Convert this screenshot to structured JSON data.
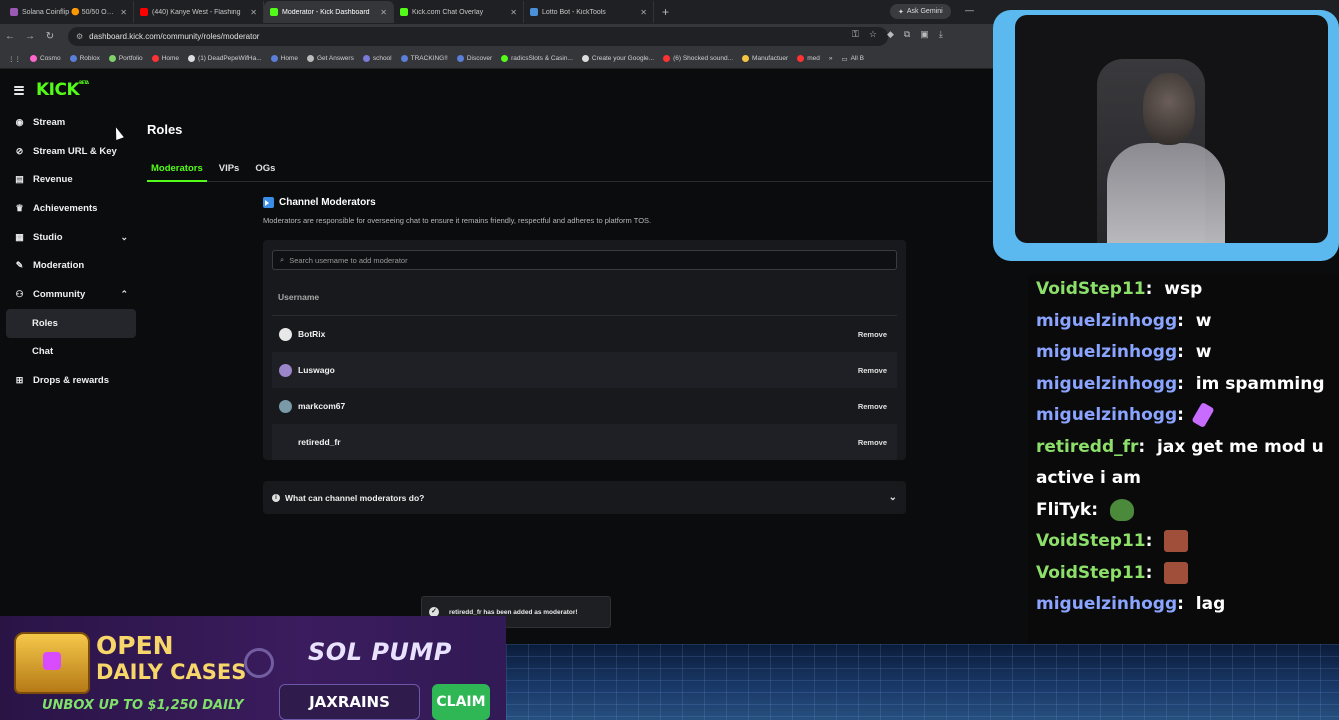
{
  "browser": {
    "tabs": [
      {
        "label": "Solana Coinflip 🟠 50/50 Odds",
        "color": "#9b59b6",
        "active": false
      },
      {
        "label": "(440) Kanye West - Flashing",
        "color": "#ff0000",
        "active": false
      },
      {
        "label": "Moderator - Kick Dashboard",
        "color": "#53fc18",
        "active": true
      },
      {
        "label": "Kick.com Chat Overlay",
        "color": "#53fc18",
        "active": false
      },
      {
        "label": "Lotto Bot - KickTools",
        "color": "#4a90d9",
        "active": false
      }
    ],
    "ask_gemini": "Ask Gemini",
    "url": "dashboard.kick.com/community/roles/moderator",
    "bookmarks": [
      {
        "label": "Cosmo",
        "color": "#ff66cc"
      },
      {
        "label": "Roblox",
        "color": "#5a7fd8"
      },
      {
        "label": "Portfolio",
        "color": "#7fd06a"
      },
      {
        "label": "Home",
        "color": "#ff3333"
      },
      {
        "label": "(1) DeadPepeWifHa...",
        "color": "#dddddd"
      },
      {
        "label": "Home",
        "color": "#5a7fd8"
      },
      {
        "label": "Get Answers",
        "color": "#bbbbbb"
      },
      {
        "label": "school",
        "color": "#7a7ad8"
      },
      {
        "label": "TRACKING!!",
        "color": "#5a7fd8"
      },
      {
        "label": "Discover",
        "color": "#5a7fd8"
      },
      {
        "label": "radicsSlots & Casin...",
        "color": "#53fc18"
      },
      {
        "label": "Create your Google...",
        "color": "#dddddd"
      },
      {
        "label": "(6) Shocked sound...",
        "color": "#ff3333"
      },
      {
        "label": "Manufactuer",
        "color": "#f5c542"
      },
      {
        "label": "med",
        "color": "#ff3333"
      }
    ],
    "all_bookmarks": "All B"
  },
  "kick": {
    "logo": "KICK",
    "beta": "BETA",
    "sidebar": [
      {
        "label": "Stream",
        "icon": "broadcast-icon"
      },
      {
        "label": "Stream URL & Key",
        "icon": "link-icon"
      },
      {
        "label": "Revenue",
        "icon": "wallet-icon"
      },
      {
        "label": "Achievements",
        "icon": "trophy-icon"
      },
      {
        "label": "Studio",
        "icon": "studio-icon",
        "chevron": "down"
      },
      {
        "label": "Moderation",
        "icon": "wrench-icon"
      },
      {
        "label": "Community",
        "icon": "community-icon",
        "chevron": "up"
      },
      {
        "label": "Roles",
        "sub": true,
        "active": true
      },
      {
        "label": "Chat",
        "sub": true
      },
      {
        "label": "Drops & rewards",
        "icon": "gift-icon"
      }
    ],
    "page_title": "Roles",
    "tabs": [
      "Moderators",
      "VIPs",
      "OGs"
    ],
    "section_title": "Channel Moderators",
    "section_desc": "Moderators are responsible for overseeing chat to ensure it remains friendly, respectful and adheres to platform TOS.",
    "search_placeholder": "Search username to add moderator",
    "column_username": "Username",
    "moderators": [
      {
        "name": "BotRix",
        "avatar": "#e8e8e8",
        "remove": "Remove"
      },
      {
        "name": "Luswago",
        "avatar": "#9a86c8",
        "remove": "Remove"
      },
      {
        "name": "markcom67",
        "avatar": "#7a9aa8",
        "remove": "Remove"
      },
      {
        "name": "retiredd_fr",
        "avatar": "",
        "remove": "Remove"
      }
    ],
    "faq": "What can channel moderators do?",
    "toast": "retiredd_fr has been added as moderator!"
  },
  "chat": [
    {
      "user": "VoidStep11",
      "color": "green",
      "text": "wsp"
    },
    {
      "user": "miguelzinhogg",
      "color": "blue",
      "text": "w"
    },
    {
      "user": "miguelzinhogg",
      "color": "blue",
      "text": "w"
    },
    {
      "user": "miguelzinhogg",
      "color": "blue",
      "text": "im spamming"
    },
    {
      "user": "miguelzinhogg",
      "color": "blue",
      "text": "",
      "emote": "#c86bff"
    },
    {
      "user": "retiredd_fr",
      "color": "green",
      "text": "jax get me mod u"
    },
    {
      "user": "",
      "color": "green",
      "text": "active i am"
    },
    {
      "user": "FliTyk",
      "color": "white",
      "text": "",
      "emote": "#4a8a3a"
    },
    {
      "user": "VoidStep11",
      "color": "green",
      "text": "",
      "emote": "#a0503a"
    },
    {
      "user": "VoidStep11",
      "color": "green",
      "text": "",
      "emote": "#a0503a"
    },
    {
      "user": "miguelzinhogg",
      "color": "blue",
      "text": "lag"
    }
  ],
  "banner": {
    "line1": "OPEN",
    "line2": "DAILY CASES",
    "unbox": "UNBOX UP TO $1,250 DAILY",
    "brand": "SOL PUMP",
    "code": "JAXRAINS",
    "claim": "CLAIM"
  }
}
